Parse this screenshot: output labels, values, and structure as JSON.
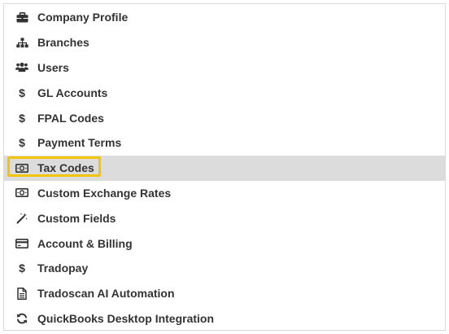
{
  "menu": {
    "items": [
      {
        "label": "Company Profile",
        "icon": "briefcase-icon"
      },
      {
        "label": "Branches",
        "icon": "sitemap-icon"
      },
      {
        "label": "Users",
        "icon": "users-icon"
      },
      {
        "label": "GL Accounts",
        "icon": "dollar-icon"
      },
      {
        "label": "FPAL Codes",
        "icon": "dollar-icon"
      },
      {
        "label": "Payment Terms",
        "icon": "dollar-icon"
      },
      {
        "label": "Tax Codes",
        "icon": "money-bill-icon",
        "selected": true
      },
      {
        "label": "Custom Exchange Rates",
        "icon": "money-bill-icon"
      },
      {
        "label": "Custom Fields",
        "icon": "magic-wand-icon"
      },
      {
        "label": "Account & Billing",
        "icon": "credit-card-icon"
      },
      {
        "label": "Tradopay",
        "icon": "dollar-icon"
      },
      {
        "label": "Tradoscan AI Automation",
        "icon": "file-text-icon"
      },
      {
        "label": "QuickBooks Desktop Integration",
        "icon": "sync-icon"
      }
    ]
  },
  "colors": {
    "active_background": "#dcdcdc",
    "highlight_border": "#f2c500",
    "text": "#333333"
  },
  "glyphs": {
    "dollar": "$"
  }
}
